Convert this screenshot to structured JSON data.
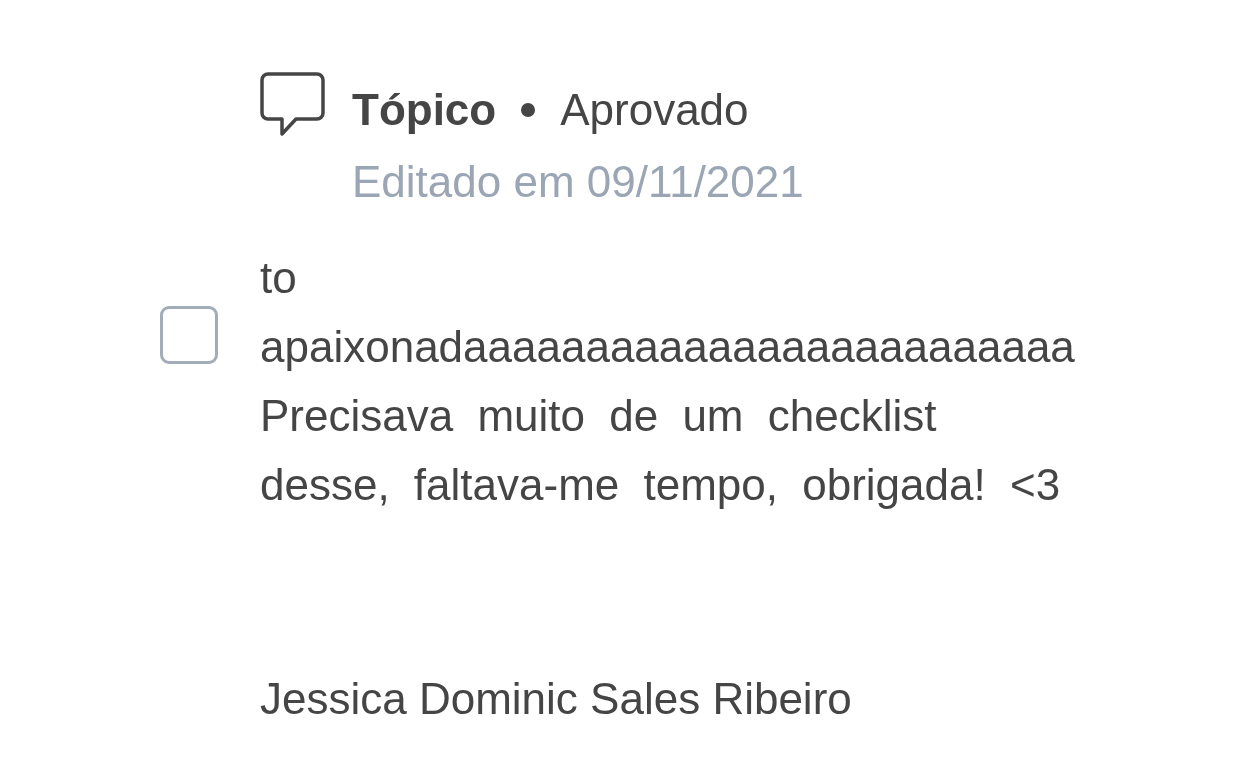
{
  "post": {
    "category": "Tópico",
    "status": "Aprovado",
    "edited": "Editado em 09/11/2021"
  },
  "comment": {
    "checked": false,
    "text": "to apaixonadaaaaaaaaaaaaaaaaaaaaaaaaa Precisava muito de um checklist desse, faltava-me tempo, obrigada! <3",
    "author": "Jessica Dominic Sales Ribeiro"
  }
}
